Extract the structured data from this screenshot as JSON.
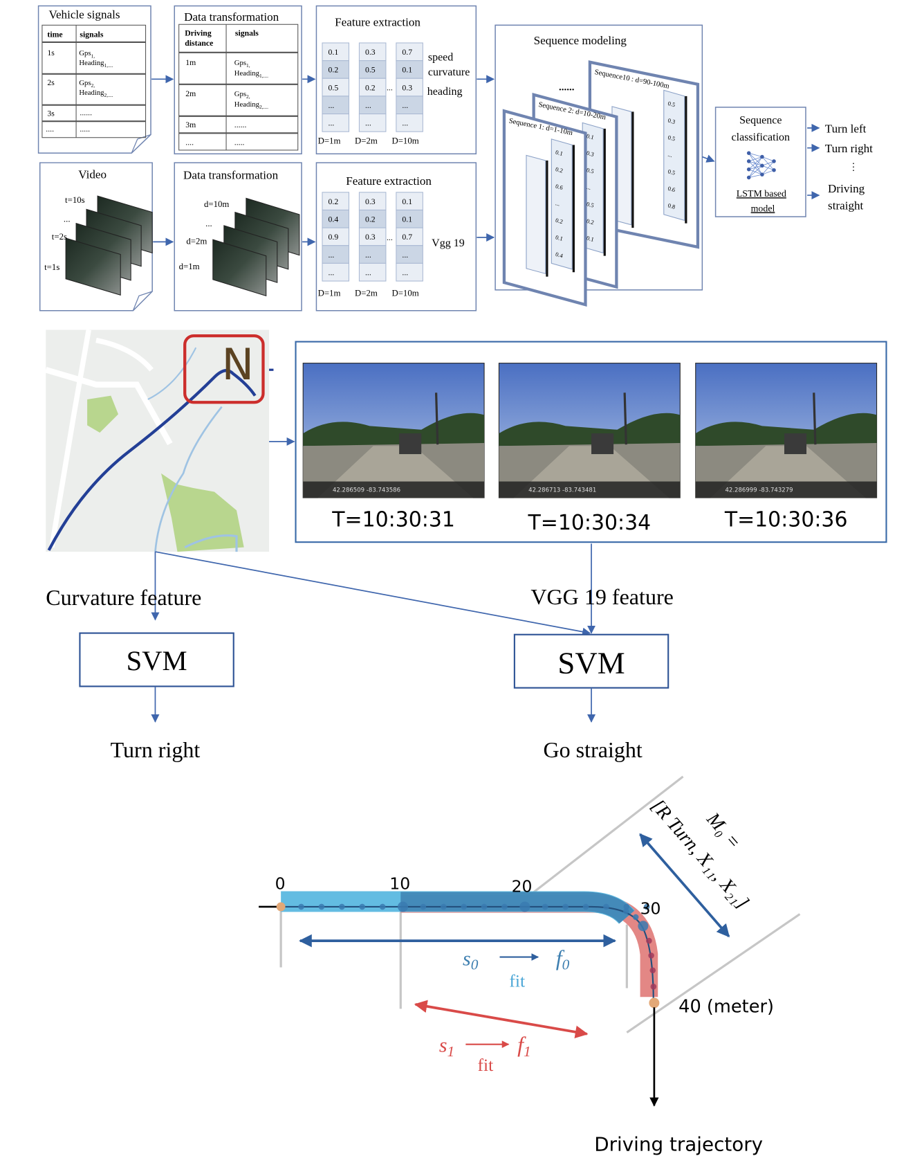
{
  "pipeline": {
    "vehicle_signals": {
      "title": "Vehicle signals",
      "headers": [
        "time",
        "signals"
      ],
      "rows": [
        [
          "1s",
          "Gps1, Heading1,..."
        ],
        [
          "2s",
          "Gps2, Heading2,..."
        ],
        [
          "3s",
          "......"
        ],
        [
          "....",
          "....."
        ]
      ]
    },
    "data_transformation_top": {
      "title": "Data transformation",
      "headers": [
        "Driving distance",
        "signals"
      ],
      "rows": [
        [
          "1m",
          "Gps1, Heading1,..."
        ],
        [
          "2m",
          "Gps2, Heading2,..."
        ],
        [
          "3m",
          "......"
        ],
        [
          "....",
          "....."
        ]
      ]
    },
    "feature_extraction_top": {
      "title": "Feature extraction",
      "columns": [
        {
          "label": "D=1m",
          "values": [
            "0.1",
            "0.2",
            "0.5",
            "...",
            "..."
          ]
        },
        {
          "label": "D=2m",
          "values": [
            "0.3",
            "0.5",
            "0.2",
            "...",
            "..."
          ]
        },
        {
          "label": "D=10m",
          "values": [
            "0.7",
            "0.1",
            "0.3",
            "...",
            "..."
          ]
        }
      ],
      "ellipsis": "...",
      "row_labels": [
        "speed",
        "curvature",
        "heading"
      ]
    },
    "video": {
      "title": "Video",
      "frame_labels": [
        "t=10s",
        "...",
        "t=2s",
        "t=1s"
      ]
    },
    "data_transformation_bottom": {
      "title": "Data transformation",
      "frame_labels": [
        "d=10m",
        "...",
        "d=2m",
        "d=1m"
      ]
    },
    "feature_extraction_bottom": {
      "title": "Feature extraction",
      "columns": [
        {
          "label": "D=1m",
          "values": [
            "0.2",
            "0.4",
            "0.9",
            "...",
            "..."
          ]
        },
        {
          "label": "D=2m",
          "values": [
            "0.3",
            "0.2",
            "0.3",
            "...",
            "..."
          ]
        },
        {
          "label": "D=10m",
          "values": [
            "0.1",
            "0.1",
            "0.7",
            "...",
            "..."
          ]
        }
      ],
      "ellipsis": "...",
      "side_label": "Vgg 19"
    },
    "sequence_modeling": {
      "title": "Sequence modeling",
      "ellipsis": "......",
      "sequences": [
        {
          "label": "Sequence10 : d=90-100m",
          "values": [
            "0.5",
            "0.3",
            "0.5",
            "...",
            "0.5",
            "0.6",
            "0.8"
          ]
        },
        {
          "label": "Sequence 2: d=10-20m",
          "values": [
            "0.1",
            "0.3",
            "0.5",
            "...",
            "0.5",
            "0.2",
            "0.1"
          ]
        },
        {
          "label": "Sequence 1: d=1-10m",
          "values": [
            "0.1",
            "0.2",
            "0.6",
            "...",
            "0.2",
            "0.1",
            "0.4"
          ]
        }
      ],
      "front_values_2": [
        "0.5",
        "0.3",
        "0.5",
        "...",
        "0.5",
        "0.6",
        "0.8"
      ]
    },
    "sequence_classification": {
      "title_line1": "Sequence",
      "title_line2": "classification",
      "model_line1": "LSTM based",
      "model_line2": "model",
      "outputs": [
        "Turn left",
        "Turn right",
        "⋮",
        "Driving",
        "straight"
      ]
    }
  },
  "example": {
    "map": {
      "north_label": "N"
    },
    "frames": [
      {
        "time": "T=10:30:31",
        "overlay": "42.286509 -83.743586"
      },
      {
        "time": "T=10:30:34",
        "overlay": "42.286713 -83.743481"
      },
      {
        "time": "T=10:30:36",
        "overlay": "42.286999 -83.743279"
      }
    ],
    "left_branch": {
      "feature": "Curvature feature",
      "model": "SVM",
      "result": "Turn right"
    },
    "right_branch": {
      "feature": "VGG 19 feature",
      "model": "SVM",
      "result": "Go straight"
    }
  },
  "trajectory": {
    "distance_ticks": [
      "0",
      "10",
      "20",
      "30",
      "40 (meter)"
    ],
    "segment0": {
      "s": "s",
      "s_sub": "0",
      "f": "f",
      "f_sub": "0",
      "fit": "fit"
    },
    "segment1": {
      "s": "s",
      "s_sub": "1",
      "f": "f",
      "f_sub": "1",
      "fit": "fit"
    },
    "model_label_line1": "M₀ =",
    "model_label_line2": "[R Turn, X₁₁, X₂₁]",
    "caption": "Driving trajectory",
    "colors": {
      "seg0": "#5bb8e0",
      "seg0_dark": "#3d7fb0",
      "seg1": "#e07a78",
      "arrow_blue": "#2e5f9e",
      "arrow_red": "#d94a48"
    }
  }
}
